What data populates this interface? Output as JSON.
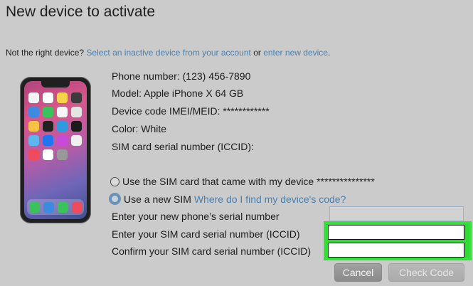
{
  "title": "New device to activate",
  "not_right": {
    "prefix": "Not the right device? ",
    "link_inactive": "Select an inactive device from your account",
    "middle": " or ",
    "link_new": "enter new device",
    "suffix": "."
  },
  "device": {
    "phone_number": "Phone number: (123) 456-7890",
    "model": "Model: Apple iPhone X 64 GB",
    "device_code": "Device code IMEI/MEID: ************",
    "color": "Color: White",
    "sim_serial": "SIM card serial number (ICCID):"
  },
  "sim_options": {
    "same_sim": "Use the SIM card that came with my device ***************",
    "new_sim": "Use a new SIM",
    "help_link": "Where do I find my device's code?"
  },
  "fields": {
    "phone_serial_label": "Enter your new phone’s serial number",
    "sim_serial_label": "Enter your SIM card serial number (ICCID)",
    "confirm_sim_label": "Confirm your SIM card serial number (ICCID)",
    "phone_serial_value": "",
    "sim_serial_value": "",
    "confirm_sim_value": ""
  },
  "buttons": {
    "cancel": "Cancel",
    "check_code": "Check Code"
  },
  "colors": {
    "background": "#cbcbcb",
    "link": "#4a7fae",
    "highlight": "#36e03b"
  }
}
